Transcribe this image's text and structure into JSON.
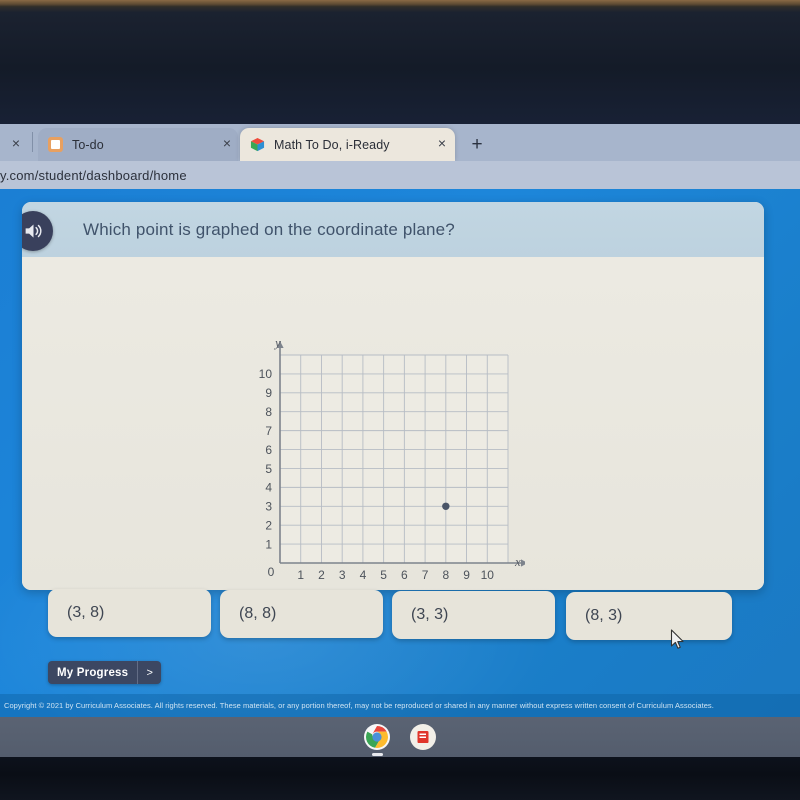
{
  "browser": {
    "tabs": [
      {
        "title": "To-do",
        "favicon": "contact-card-icon",
        "active": false,
        "close_label": "×"
      },
      {
        "title": "Math To Do, i-Ready",
        "favicon": "iready-cube-icon",
        "active": true,
        "close_label": "×"
      }
    ],
    "leftmost_close_label": "×",
    "new_tab_label": "+",
    "url": "y.com/student/dashboard/home"
  },
  "question": {
    "speaker_icon": "speaker-icon",
    "text": "Which point is graphed on the coordinate plane?"
  },
  "chart_data": {
    "type": "scatter",
    "title": "",
    "xlabel": "x",
    "ylabel": "y",
    "xlim": [
      0,
      11
    ],
    "ylim": [
      0,
      11
    ],
    "xticks": [
      0,
      1,
      2,
      3,
      4,
      5,
      6,
      7,
      8,
      9,
      10
    ],
    "yticks": [
      1,
      2,
      3,
      4,
      5,
      6,
      7,
      8,
      9,
      10
    ],
    "origin_label": "0",
    "grid": true,
    "points": [
      {
        "x": 8,
        "y": 3
      }
    ],
    "point_color": "#4a5568",
    "grid_color": "#b6bcc4",
    "axis_color": "#7d838c",
    "plot_bg": "#edebe3"
  },
  "answers": [
    {
      "label": "(3, 8)"
    },
    {
      "label": "(8, 8)"
    },
    {
      "label": "(3, 3)"
    },
    {
      "label": "(8, 3)"
    }
  ],
  "footer": {
    "progress_label": "My Progress",
    "progress_chevron": ">",
    "copyright": "Copyright © 2021 by Curriculum Associates. All rights reserved. These materials, or any portion thereof, may not be reproduced or shared in any manner without express written consent of Curriculum Associates."
  },
  "taskbar": {
    "icons": [
      {
        "name": "chrome-icon"
      },
      {
        "name": "app-icon-red"
      }
    ]
  },
  "colors": {
    "app_blue": "#1b7fd4",
    "card_bg": "#e9e7df",
    "header_blue": "#c2d6e2",
    "progress_navy": "#3c4762"
  }
}
